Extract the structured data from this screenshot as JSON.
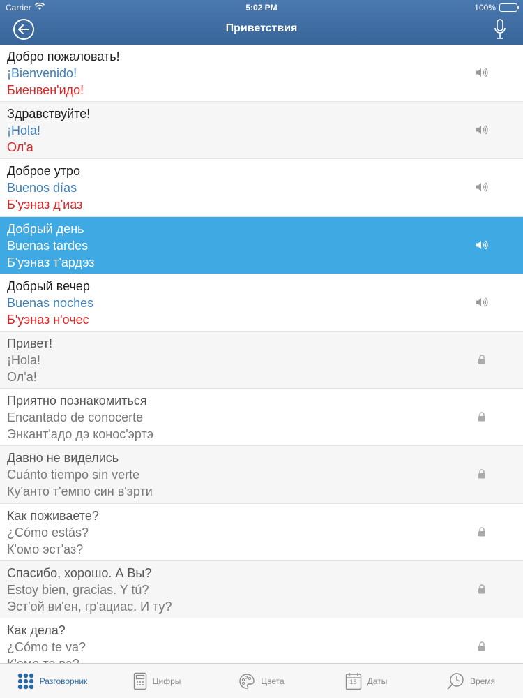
{
  "status": {
    "carrier": "Carrier",
    "time": "5:02 PM",
    "battery": "100%"
  },
  "header": {
    "title": "Приветствия"
  },
  "rows": [
    {
      "ru": "Добро пожаловать!",
      "es": "¡Bienvenido!",
      "tr": "Биенвен'идо!",
      "icon": "speaker-icon"
    },
    {
      "ru": "Здравствуйте!",
      "es": "¡Hola!",
      "tr": "Ол'а",
      "icon": "speaker-icon"
    },
    {
      "ru": "Доброе утро",
      "es": "Buenos días",
      "tr": "Б'уэназ д'иаз",
      "icon": "speaker-icon"
    },
    {
      "ru": "Добрый день",
      "es": "Buenas tardes",
      "tr": "Б'уэназ т'ардэз",
      "icon": "speaker-icon"
    },
    {
      "ru": "Добрый вечер",
      "es": "Buenas noches",
      "tr": "Б'уэназ н'очес",
      "icon": "speaker-icon"
    },
    {
      "ru": "Привет!",
      "es": "¡Hola!",
      "tr": "Ол'а!",
      "icon": "lock-icon"
    },
    {
      "ru": "Приятно познакомиться",
      "es": "Encantado de conocerte",
      "tr": "Энкант'адо дэ конос'эртэ",
      "icon": "lock-icon"
    },
    {
      "ru": "Давно не виделись",
      "es": "Cuánto tiempo sin verte",
      "tr": "Ку'анто т'емпо син в'эрти",
      "icon": "lock-icon"
    },
    {
      "ru": "Как поживаете?",
      "es": "¿Cómo estás?",
      "tr": "К'омо эст'аз?",
      "icon": "lock-icon"
    },
    {
      "ru": "Спасибо, хорошо. А Вы?",
      "es": "Estoy bien, gracias. Y tú?",
      "tr": "Эст'ой ви'ен, гр'ациас. И ту?",
      "icon": "lock-icon"
    },
    {
      "ru": "Как дела?",
      "es": "¿Cómo te va?",
      "tr": "К'омо те ва?",
      "icon": "lock-icon"
    }
  ],
  "tabs": [
    {
      "label": "Разговорник",
      "icon": "grid-icon"
    },
    {
      "label": "Цифры",
      "icon": "calculator-icon"
    },
    {
      "label": "Цвета",
      "icon": "palette-icon"
    },
    {
      "label": "Даты",
      "icon": "calendar-icon",
      "calendar_day": "15"
    },
    {
      "label": "Время",
      "icon": "clock-icon"
    }
  ],
  "colors": {
    "header": "#3f6fa6",
    "selected_row": "#3ea9e2",
    "spanish": "#3f7fb8",
    "transcription": "#e02424",
    "active_tab": "#2a6aa8"
  }
}
